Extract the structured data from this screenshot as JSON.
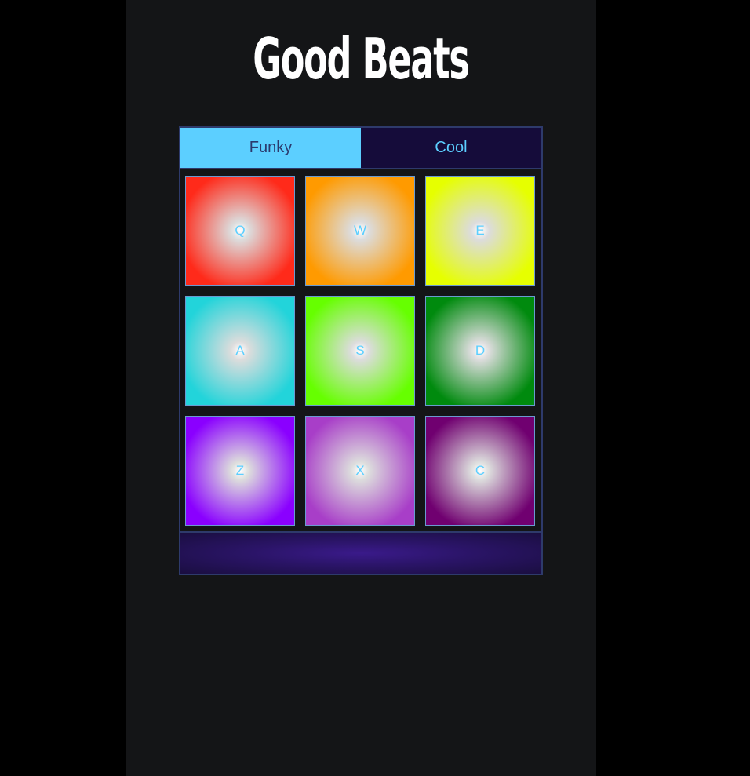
{
  "app": {
    "title": "Good Beats"
  },
  "tabs": [
    {
      "label": "Funky",
      "active": true
    },
    {
      "label": "Cool",
      "active": false
    }
  ],
  "pads": [
    {
      "key": "Q",
      "color": "#ff2a1a"
    },
    {
      "key": "W",
      "color": "#ff9a00"
    },
    {
      "key": "E",
      "color": "#e6ff00"
    },
    {
      "key": "A",
      "color": "#22d4da"
    },
    {
      "key": "S",
      "color": "#66ff00"
    },
    {
      "key": "D",
      "color": "#008a0e"
    },
    {
      "key": "Z",
      "color": "#8a00ff"
    },
    {
      "key": "X",
      "color": "#a83ec8"
    },
    {
      "key": "C",
      "color": "#700070"
    }
  ],
  "colors": {
    "accent": "#5ccfff",
    "panel_border": "#2e3a6b",
    "inactive_tab": "#150c3a",
    "background": "#141517"
  }
}
